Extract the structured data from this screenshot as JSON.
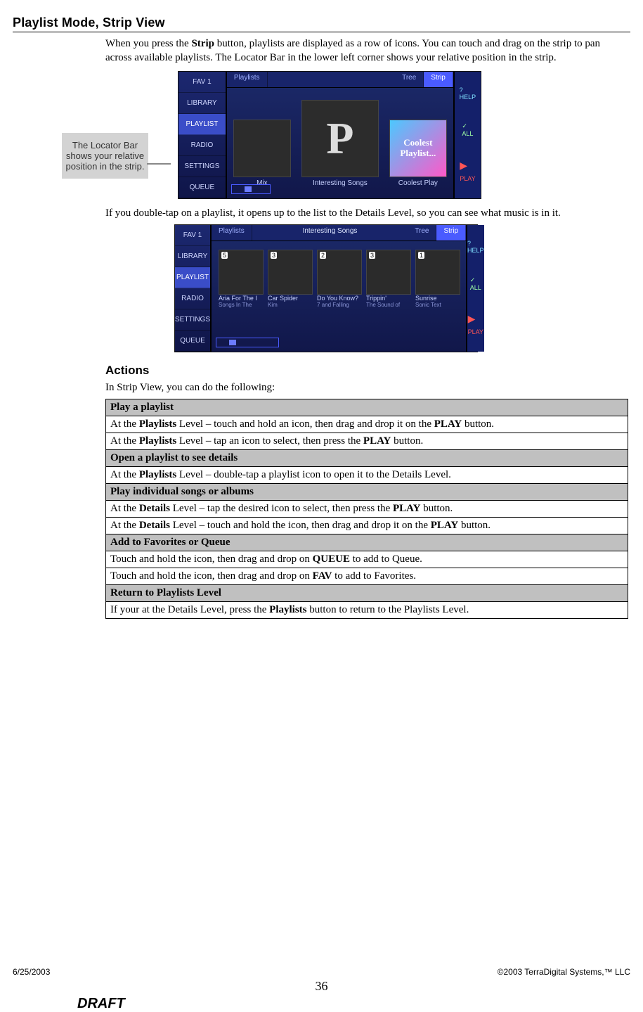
{
  "header": {
    "title": "Playlist Mode, Strip View"
  },
  "paras": {
    "p1a": "When you press the ",
    "p1b": "Strip",
    "p1c": " button, playlists are displayed as a row of icons.  You can touch and drag on the strip to pan across available playlists.  The Locator Bar in the lower left corner shows your relative position in the strip.",
    "p2": "If you double-tap on a playlist, it opens up to the list to the Details Level, so you can see what music is in it.",
    "p3": "In Strip View, you can do the following:"
  },
  "callout": "The Locator Bar shows your relative position in the strip.",
  "sections": {
    "actions": "Actions"
  },
  "shot1": {
    "sidebar": [
      "FAV 1",
      "LIBRARY",
      "PLAYLIST",
      "RADIO",
      "SETTINGS",
      "QUEUE"
    ],
    "sidebar_sel": 2,
    "topbar": {
      "left": "Playlists",
      "title": "",
      "right1": "Tree",
      "right2": "Strip"
    },
    "rightbar": {
      "help": "HELP",
      "all": "ALL",
      "play": "PLAY"
    },
    "tiles": [
      {
        "label": "Mix",
        "big": false,
        "glyph": ""
      },
      {
        "label": "Interesting Songs",
        "big": true,
        "glyph": "P"
      },
      {
        "label": "Coolest Play",
        "big": false,
        "coolest": true,
        "glyph": "Coolest Playlist..."
      }
    ]
  },
  "shot2": {
    "sidebar": [
      "FAV 1",
      "LIBRARY",
      "PLAYLIST",
      "RADIO",
      "SETTINGS",
      "QUEUE"
    ],
    "sidebar_sel": 2,
    "topbar": {
      "left": "Playlists",
      "title": "Interesting Songs",
      "right1": "Tree",
      "right2": "Strip"
    },
    "rightbar": {
      "help": "HELP",
      "all": "ALL",
      "play": "PLAY"
    },
    "songs": [
      {
        "n": "5",
        "t": "Aria For The I",
        "s": "Songs In The"
      },
      {
        "n": "3",
        "t": "Car Spider",
        "s": "Kim"
      },
      {
        "n": "2",
        "t": "Do You Know?",
        "s": "7 and Falling"
      },
      {
        "n": "3",
        "t": "Trippin'",
        "s": "The Sound of"
      },
      {
        "n": "1",
        "t": "Sunrise",
        "s": "Sonic Text"
      }
    ]
  },
  "actions": [
    {
      "type": "hd",
      "txt": "Play a playlist"
    },
    {
      "type": "row",
      "segs": [
        [
          "",
          "At the "
        ],
        [
          "b",
          "Playlists"
        ],
        [
          "",
          " Level – touch and hold an icon, then drag and drop it on the "
        ],
        [
          "b",
          "PLAY"
        ],
        [
          "",
          " button."
        ]
      ]
    },
    {
      "type": "row",
      "segs": [
        [
          "",
          "At the "
        ],
        [
          "b",
          "Playlists"
        ],
        [
          "",
          " Level – tap an icon to select, then press the "
        ],
        [
          "b",
          "PLAY"
        ],
        [
          "",
          " button."
        ]
      ]
    },
    {
      "type": "hd",
      "txt": "Open a playlist to see details"
    },
    {
      "type": "row",
      "segs": [
        [
          "",
          "At the "
        ],
        [
          "b",
          "Playlists"
        ],
        [
          "",
          " Level – double-tap a playlist icon to open it to the Details Level."
        ]
      ]
    },
    {
      "type": "hd",
      "txt": "Play individual songs or albums"
    },
    {
      "type": "row",
      "segs": [
        [
          "",
          "At the "
        ],
        [
          "b",
          "Details"
        ],
        [
          "",
          " Level – tap the desired icon to select, then press the "
        ],
        [
          "b",
          "PLAY"
        ],
        [
          "",
          " button."
        ]
      ]
    },
    {
      "type": "row",
      "segs": [
        [
          "",
          "At the "
        ],
        [
          "b",
          "Details"
        ],
        [
          "",
          " Level – touch and hold the icon, then drag and drop it on the "
        ],
        [
          "b",
          "PLAY"
        ],
        [
          "",
          " button."
        ]
      ]
    },
    {
      "type": "hd",
      "txt": "Add to Favorites or Queue"
    },
    {
      "type": "row",
      "segs": [
        [
          "",
          "Touch and hold the icon, then drag and drop on "
        ],
        [
          "b",
          "QUEUE"
        ],
        [
          "",
          " to add to Queue."
        ]
      ]
    },
    {
      "type": "row",
      "segs": [
        [
          "",
          "Touch and hold the icon, then drag and drop on "
        ],
        [
          "b",
          "FAV"
        ],
        [
          "",
          " to add to Favorites."
        ]
      ]
    },
    {
      "type": "hd",
      "txt": "Return to Playlists Level"
    },
    {
      "type": "row",
      "segs": [
        [
          "",
          "If your at the Details Level, press the "
        ],
        [
          "b",
          "Playlists"
        ],
        [
          "",
          " button to return to the Playlists Level."
        ]
      ]
    }
  ],
  "footer": {
    "date": "6/25/2003",
    "copyright": "©2003 TerraDigital Systems,™ LLC",
    "page": "36",
    "draft": "DRAFT"
  }
}
